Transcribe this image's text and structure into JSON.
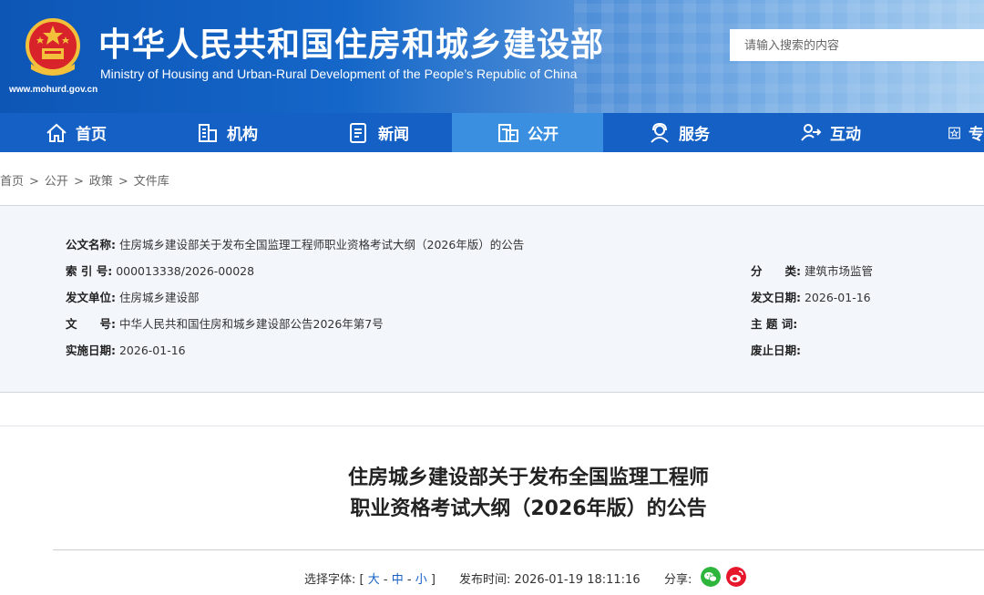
{
  "header": {
    "title_cn": "中华人民共和国住房和城乡建设部",
    "title_en": "Ministry of Housing and Urban-Rural Development of the People’s Republic of China",
    "site_url": "www.mohurd.gov.cn",
    "search_placeholder": "请输入搜索的内容",
    "brand_color": "#1560c4"
  },
  "nav": {
    "items": [
      {
        "label": "首页",
        "icon": "home-icon"
      },
      {
        "label": "机构",
        "icon": "building-icon"
      },
      {
        "label": "新闻",
        "icon": "news-icon"
      },
      {
        "label": "公开",
        "icon": "document-icon",
        "active": true
      },
      {
        "label": "服务",
        "icon": "service-icon"
      },
      {
        "label": "互动",
        "icon": "interaction-icon"
      },
      {
        "label": "专",
        "icon": "star-icon"
      }
    ]
  },
  "breadcrumb": {
    "items": [
      "首页",
      "公开",
      "政策",
      "文件库"
    ],
    "separator": ">"
  },
  "info": {
    "name_label": "公文名称:",
    "name_value": "住房城乡建设部关于发布全国监理工程师职业资格考试大纲（2026年版）的公告",
    "index_label": "索 引 号:",
    "index_value": "000013338/2026-00028",
    "unit_label": "发文单位:",
    "unit_value": "住房城乡建设部",
    "doc_label": "文　　号:",
    "doc_value": "中华人民共和国住房和城乡建设部公告2026年第7号",
    "impl_label": "实施日期:",
    "impl_value": "2026-01-16",
    "category_label": "分　　类:",
    "category_value": "建筑市场监管",
    "issue_label": "发文日期:",
    "issue_value": "2026-01-16",
    "topic_label": "主 题 词:",
    "topic_value": "",
    "abolish_label": "废止日期:",
    "abolish_value": ""
  },
  "article": {
    "title_line1": "住房城乡建设部关于发布全国监理工程师",
    "title_line2": "职业资格考试大纲（2026年版）的公告",
    "font_label": "选择字体:",
    "bracket_open": "[",
    "bracket_close": "]",
    "font_large": "大",
    "font_medium": "中",
    "font_small": "小",
    "font_sep": "-",
    "publish_label": "发布时间:",
    "publish_time": "2026-01-19 18:11:16",
    "share_label": "分享:",
    "share_icons": [
      "wechat-icon",
      "weibo-icon"
    ]
  }
}
